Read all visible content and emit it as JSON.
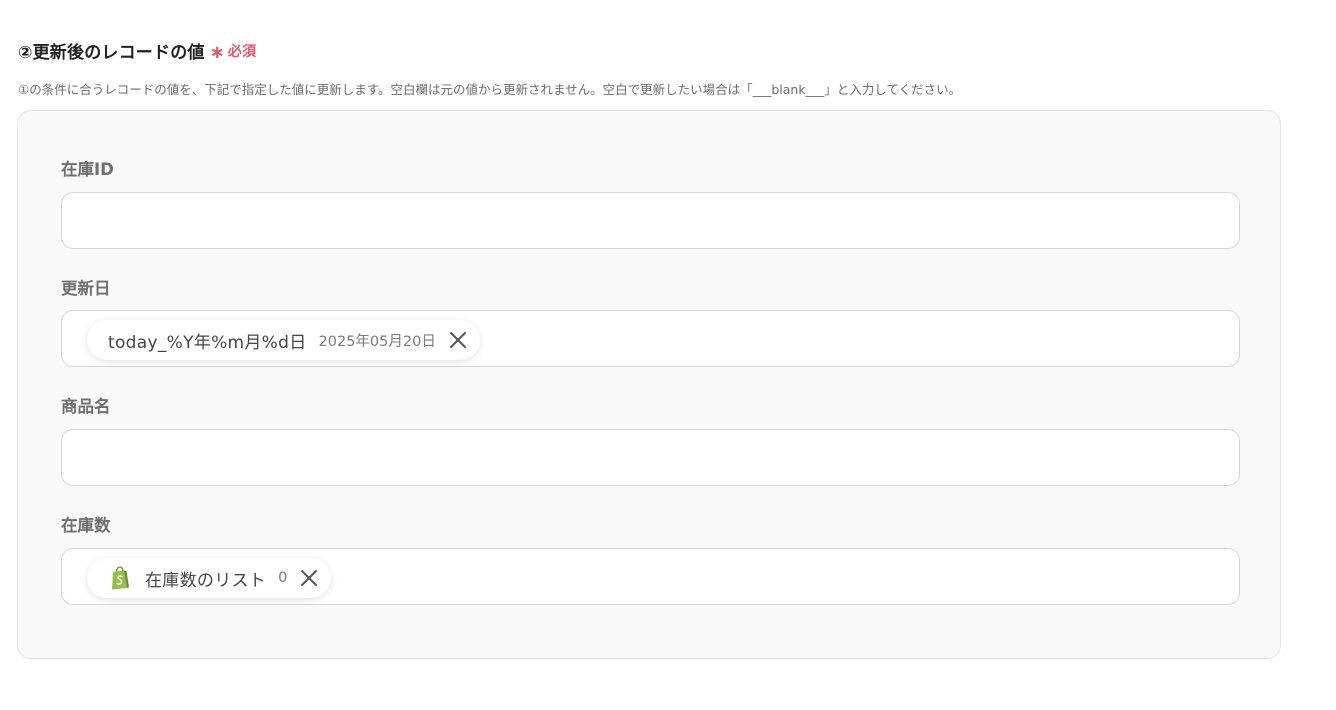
{
  "section": {
    "title": "②更新後のレコードの値",
    "required_mark": "∗",
    "required_label": "必須",
    "description": "①の条件に合うレコードの値を、下記で指定した値に更新します。空白欄は元の値から更新されません。空白で更新したい場合は「___blank___」と入力してください。"
  },
  "fields": [
    {
      "label": "在庫ID",
      "value": ""
    },
    {
      "label": "更新日",
      "chip": {
        "label": "today_%Y年%m月%d日",
        "value": "2025年05月20日",
        "icon": "close-icon"
      }
    },
    {
      "label": "商品名",
      "value": ""
    },
    {
      "label": "在庫数",
      "chip": {
        "icon_left": "shopify-icon",
        "label": "在庫数のリスト",
        "value": "0",
        "icon": "close-icon"
      }
    }
  ],
  "colors": {
    "required": "#e5566b",
    "shopify_green": "#95bf47",
    "shopify_dark": "#5e8e3e"
  }
}
